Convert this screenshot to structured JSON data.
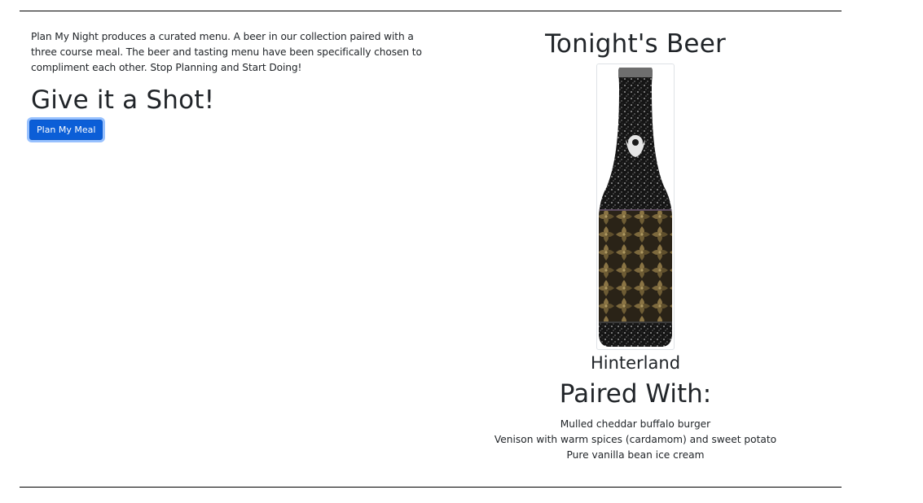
{
  "intro": {
    "text": "Plan My Night produces a curated menu. A beer in our collection paired with a three course meal. The beer and tasting menu have been specifically chosen to compliment each other. Stop Planning and Start Doing!",
    "heading": "Give it a Shot!",
    "button_label": "Plan My Meal"
  },
  "beer": {
    "heading": "Tonight's Beer",
    "name": "Hinterland",
    "image_alt": "beer-bottle-image"
  },
  "pairing": {
    "heading": "Paired With:",
    "items": [
      "Mulled cheddar buffalo burger",
      "Venison with warm spices (cardamom) and sweet potato",
      "Pure vanilla bean ice cream"
    ]
  },
  "colors": {
    "button_bg": "#0b5ed7",
    "text": "#212529",
    "rule": "#000000"
  }
}
